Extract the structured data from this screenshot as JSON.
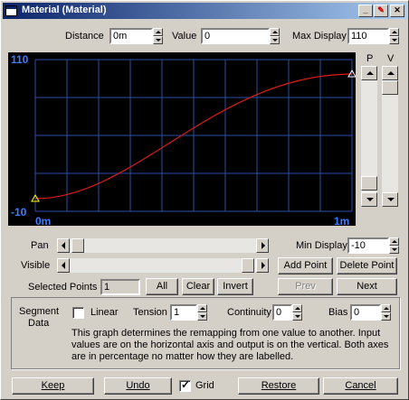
{
  "window": {
    "title": "Material (Material)"
  },
  "top": {
    "distance_label": "Distance",
    "distance_value": "0m",
    "value_label": "Value",
    "value_value": "0",
    "maxdisplay_label": "Max Display",
    "maxdisplay_value": "110"
  },
  "graph": {
    "y_max": "110",
    "y_min": "-10",
    "x_min": "0m",
    "x_max": "1m",
    "p_label": "P",
    "v_label": "V",
    "grid": true,
    "colors": {
      "background": "#000000",
      "grid": "#2a4fa8",
      "curve": "#e01a1a",
      "label": "#3c7dff",
      "point": "#ffff00"
    }
  },
  "controls": {
    "pan_label": "Pan",
    "visible_label": "Visible",
    "mindisplay_label": "Min Display",
    "mindisplay_value": "-10",
    "add_point": "Add Point",
    "delete_point": "Delete Point",
    "selected_points_label": "Selected Points",
    "selected_points_value": "1",
    "all": "All",
    "clear": "Clear",
    "invert": "Invert",
    "prev": "Prev",
    "next": "Next"
  },
  "segment": {
    "title_line1": "Segment",
    "title_line2": "Data",
    "linear_label": "Linear",
    "linear_checked": false,
    "tension_label": "Tension",
    "tension_value": "1",
    "continuity_label": "Continuity",
    "continuity_value": "0",
    "bias_label": "Bias",
    "bias_value": "0",
    "help_line1": "This graph determines the remapping from one value to another. Input",
    "help_line2": "values are on the horizontal axis and output is on the vertical. Both axes",
    "help_line3": "are in percentage no matter how they are labelled."
  },
  "bottom": {
    "keep": "Keep",
    "undo": "Undo",
    "grid_label": "Grid",
    "grid_checked": true,
    "restore": "Restore",
    "cancel": "Cancel"
  }
}
